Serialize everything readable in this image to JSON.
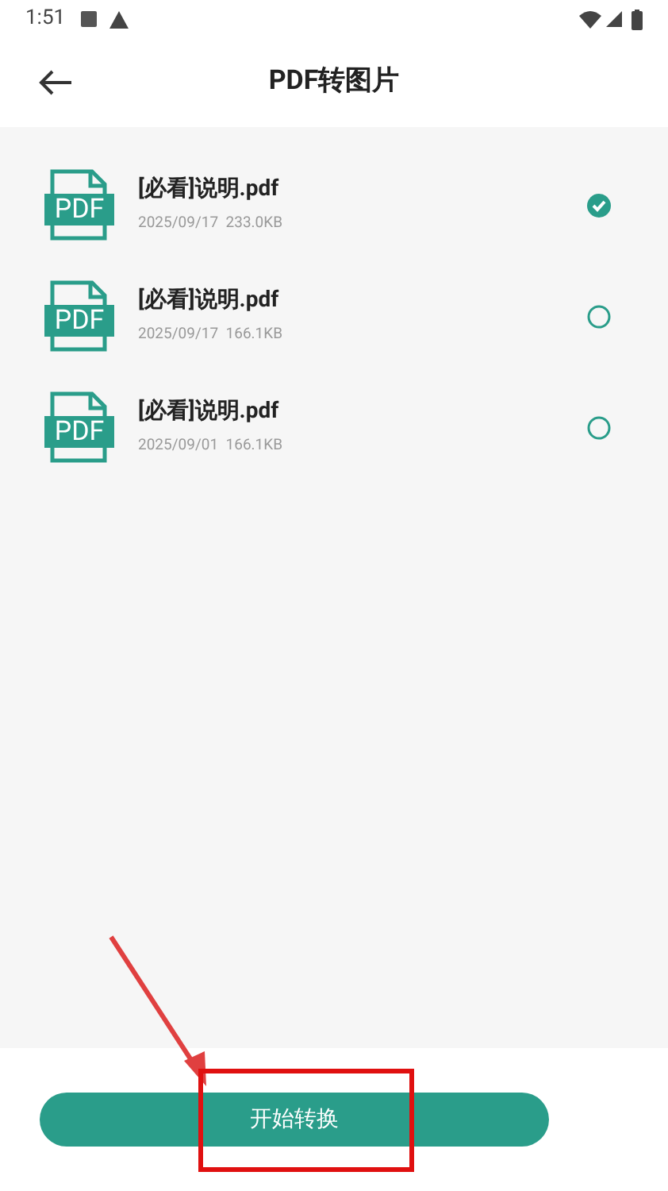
{
  "status_bar": {
    "time": "1:51"
  },
  "header": {
    "title": "PDF转图片"
  },
  "files": [
    {
      "icon_text": "PDF",
      "name": "[必看]说明.pdf",
      "date": "2025/09/17",
      "size": "233.0KB",
      "selected": true
    },
    {
      "icon_text": "PDF",
      "name": "[必看]说明.pdf",
      "date": "2025/09/17",
      "size": "166.1KB",
      "selected": false
    },
    {
      "icon_text": "PDF",
      "name": "[必看]说明.pdf",
      "date": "2025/09/01",
      "size": "166.1KB",
      "selected": false
    }
  ],
  "start_button": {
    "label": "开始转换"
  }
}
